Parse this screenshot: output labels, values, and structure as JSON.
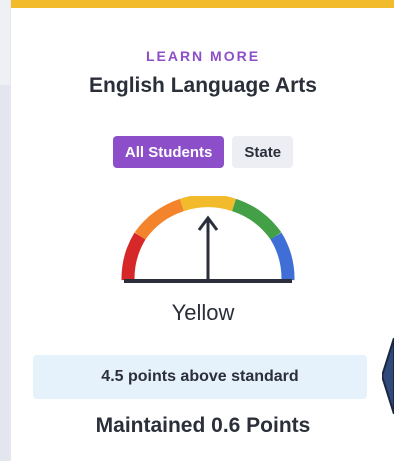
{
  "header": {
    "eyebrow": "LEARN MORE",
    "title": "English Language Arts"
  },
  "toggle": {
    "options": [
      "All Students",
      "State"
    ],
    "selected": "All Students"
  },
  "gauge": {
    "status": "Yellow",
    "colors": [
      "#d62828",
      "#f4842c",
      "#f2bb2b",
      "#43a047",
      "#3f6fd6"
    ],
    "needle_level": 3,
    "needle_color": "#2b2f3a",
    "icon": "gauge-icon"
  },
  "result": {
    "points_text": "4.5 points above standard",
    "change_text": "Maintained 0.6 Points"
  },
  "colors": {
    "accent": "#8d4fc9",
    "top_bar": "#f2bb2b",
    "points_bg": "#e5f1fb",
    "callout_arrow": "#2f4a7a"
  }
}
